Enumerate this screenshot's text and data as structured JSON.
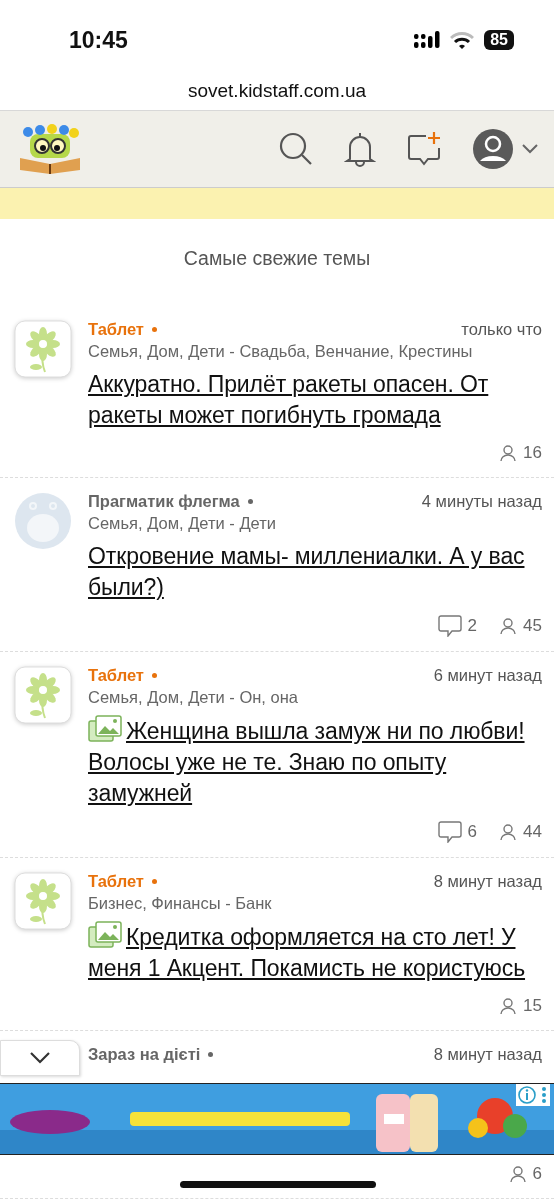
{
  "status_bar": {
    "time": "10:45",
    "battery": "85"
  },
  "browser": {
    "url": "sovet.kidstaff.com.ua"
  },
  "section_title": "Самые свежие темы",
  "topics": [
    {
      "kind": "flower",
      "author": "Таблет",
      "color": "#e8720c",
      "time": "только что",
      "category": "Семья, Дом, Дети - Свадьба, Венчание, Крестины",
      "has_image": false,
      "title": "Аккуратно. Прилёт ракеты опасен. От ракеты может погибнуть громада",
      "views": "16"
    },
    {
      "kind": "creature",
      "author": "Прагматик флегма",
      "color": "#666666",
      "time": "4 минуты назад",
      "category": "Семья, Дом, Дети - Дети",
      "has_image": false,
      "title": "Откровение мамы- миллениалки. А у вас были?)",
      "comments": "2",
      "views": "45"
    },
    {
      "kind": "flower",
      "author": "Таблет",
      "color": "#e8720c",
      "time": "6 минут назад",
      "category": "Семья, Дом, Дети - Он, она",
      "has_image": true,
      "title": "Женщина вышла замуж ни по любви! Волосы уже не те. Знаю по опыту замужней",
      "comments": "6",
      "views": "44"
    },
    {
      "kind": "flower",
      "author": "Таблет",
      "color": "#e8720c",
      "time": "8 минут назад",
      "category": "Бизнес, Финансы - Банк",
      "has_image": true,
      "title": "Кредитка оформляется на сто лет! У меня 1 Акцент. Покамисть не користуюсь",
      "views": "15"
    },
    {
      "author": "Зараз на дієті",
      "color": "#666666",
      "time": "8 минут назад",
      "views": "6"
    }
  ]
}
